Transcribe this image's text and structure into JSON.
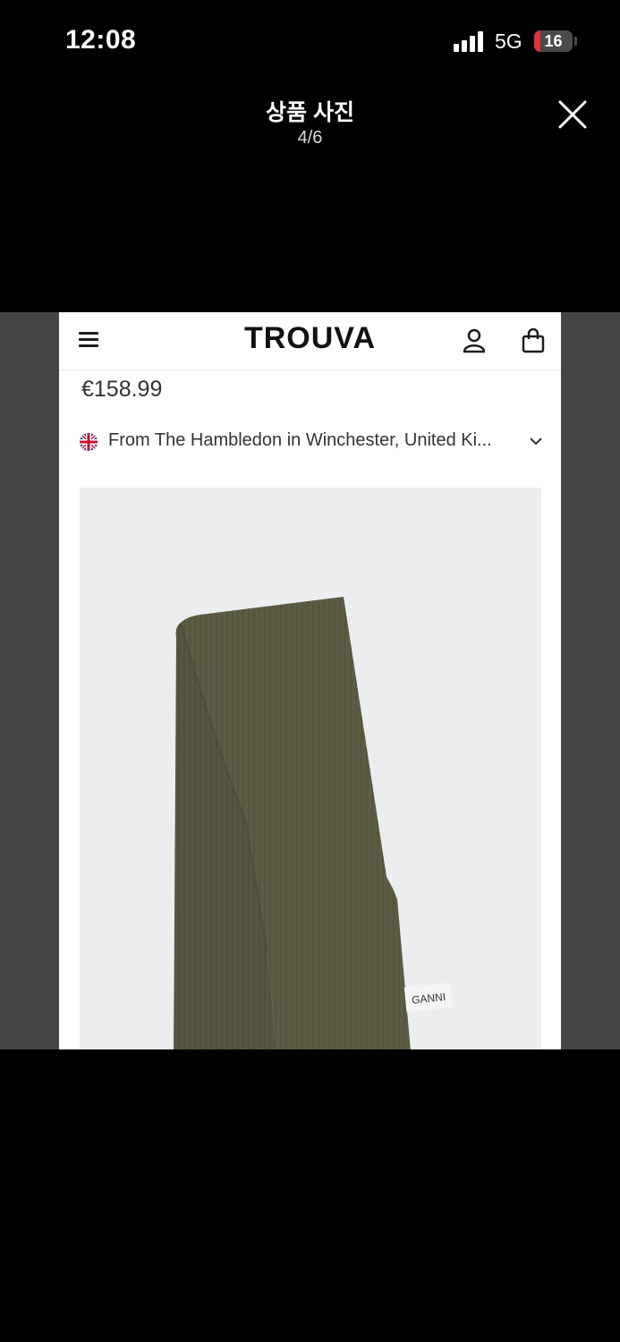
{
  "status": {
    "time": "12:08",
    "network": "5G",
    "battery_level": "16",
    "battery_fraction": 0.16
  },
  "viewer": {
    "title": "상품 사진",
    "counter": "4/6"
  },
  "store_page": {
    "logo": "TROUVA",
    "price": "€158.99",
    "from_text": "From The Hambledon in Winchester, United Ki...",
    "product_tag": "GANNI",
    "icons": [
      "menu-icon",
      "user-icon",
      "shopping-bag-icon",
      "uk-flag-icon",
      "chevron-down-icon"
    ]
  },
  "colors": {
    "background": "#000000",
    "letterbox": "#454545",
    "scarf": "#56553f",
    "battery_low": "#e0333b"
  }
}
